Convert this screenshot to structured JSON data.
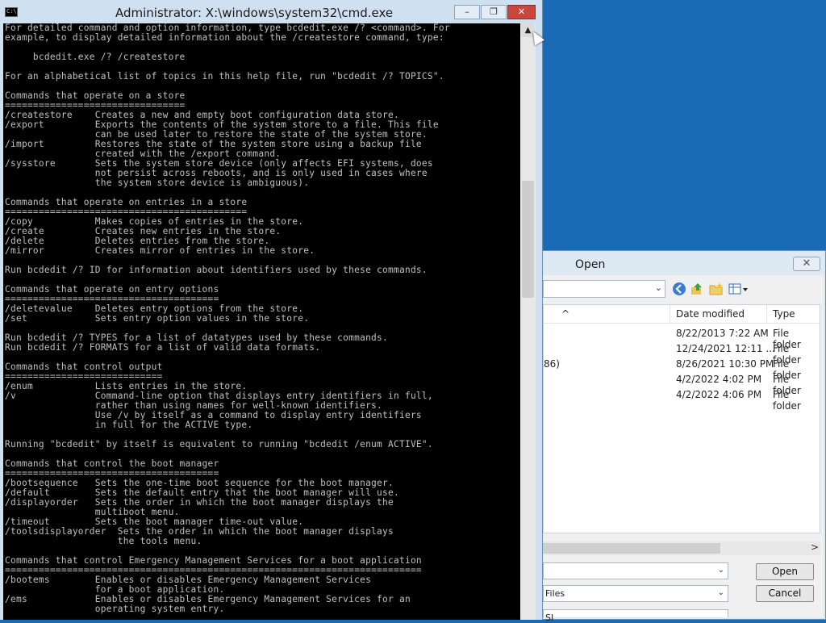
{
  "cmd_window": {
    "title": "Administrator: X:\\windows\\system32\\cmd.exe",
    "icon_text": "C:\\",
    "buttons": {
      "minimize": "–",
      "restore": "❐",
      "close": "✕"
    },
    "scroll_up": "▲",
    "console_lines": [
      "For detailed command and option information, type bcdedit.exe /? <command>. For",
      "example, to display detailed information about the /createstore command, type:",
      "",
      "     bcdedit.exe /? /createstore",
      "",
      "For an alphabetical list of topics in this help file, run \"bcdedit /? TOPICS\".",
      "",
      "Commands that operate on a store",
      "================================",
      "/createstore    Creates a new and empty boot configuration data store.",
      "/export         Exports the contents of the system store to a file. This file",
      "                can be used later to restore the state of the system store.",
      "/import         Restores the state of the system store using a backup file",
      "                created with the /export command.",
      "/sysstore       Sets the system store device (only affects EFI systems, does",
      "                not persist across reboots, and is only used in cases where",
      "                the system store device is ambiguous).",
      "",
      "Commands that operate on entries in a store",
      "===========================================",
      "/copy           Makes copies of entries in the store.",
      "/create         Creates new entries in the store.",
      "/delete         Deletes entries from the store.",
      "/mirror         Creates mirror of entries in the store.",
      "",
      "Run bcdedit /? ID for information about identifiers used by these commands.",
      "",
      "Commands that operate on entry options",
      "======================================",
      "/deletevalue    Deletes entry options from the store.",
      "/set            Sets entry option values in the store.",
      "",
      "Run bcdedit /? TYPES for a list of datatypes used by these commands.",
      "Run bcdedit /? FORMATS for a list of valid data formats.",
      "",
      "Commands that control output",
      "============================",
      "/enum           Lists entries in the store.",
      "/v              Command-line option that displays entry identifiers in full,",
      "                rather than using names for well-known identifiers.",
      "                Use /v by itself as a command to display entry identifiers",
      "                in full for the ACTIVE type.",
      "",
      "Running \"bcdedit\" by itself is equivalent to running \"bcdedit /enum ACTIVE\".",
      "",
      "Commands that control the boot manager",
      "======================================",
      "/bootsequence   Sets the one-time boot sequence for the boot manager.",
      "/default        Sets the default entry that the boot manager will use.",
      "/displayorder   Sets the order in which the boot manager displays the",
      "                multiboot menu.",
      "/timeout        Sets the boot manager time-out value.",
      "/toolsdisplayorder  Sets the order in which the boot manager displays",
      "                    the tools menu.",
      "",
      "Commands that control Emergency Management Services for a boot application",
      "==========================================================================",
      "/bootems        Enables or disables Emergency Management Services",
      "                for a boot application.",
      "/ems            Enables or disables Emergency Management Services for an",
      "                operating system entry."
    ]
  },
  "open_dialog": {
    "title": "Open",
    "close": "✕",
    "columns": {
      "sort_caret": "^",
      "date_modified": "Date modified",
      "type": "Type"
    },
    "rows": [
      {
        "name": "",
        "date": "8/22/2013 7:22 AM",
        "type": "File folder"
      },
      {
        "name": "",
        "date": "12/24/2021 12:11 ...",
        "type": "File folder"
      },
      {
        "name": "86)",
        "date": "8/26/2021 10:30 PM",
        "type": "File folder"
      },
      {
        "name": "",
        "date": "4/2/2022 4:02 PM",
        "type": "File folder"
      },
      {
        "name": "",
        "date": "4/2/2022 4:06 PM",
        "type": "File folder"
      }
    ],
    "scroll_right": ">",
    "filename_value": "",
    "filetype_value": "Files",
    "encoding_value": "SI",
    "open_label": "Open",
    "cancel_label": "Cancel",
    "dropdown_glyph": "⌄"
  }
}
